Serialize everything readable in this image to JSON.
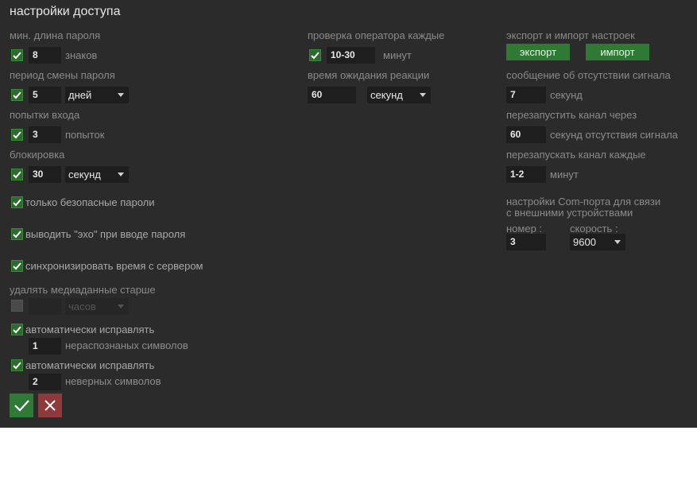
{
  "title": "настройки доступа",
  "left": {
    "min_length": {
      "label": "мин. длина пароля",
      "value": "8",
      "unit": "знаков"
    },
    "change_period": {
      "label": "период смены пароля",
      "value": "5",
      "unit_select": "дней"
    },
    "login_attempts": {
      "label": "попытки входа",
      "value": "3",
      "unit": "попыток"
    },
    "lockout": {
      "label": "блокировка",
      "value": "30",
      "unit_select": "секунд"
    },
    "safe_only": "только безопасные пароли",
    "echo": "выводить \"эхо\" при вводе пароля",
    "sync_time": "синхронизировать время с сервером",
    "delete_media": {
      "label": "удалять медиаданные старше",
      "value": "",
      "unit_select": "часов"
    },
    "autofix_unrecognized": {
      "label": "автоматически исправлять",
      "value": "1",
      "unit": "нераспознаных символов"
    },
    "autofix_wrong": {
      "label": "автоматически исправлять",
      "value": "2",
      "unit": "неверных символов"
    }
  },
  "middle": {
    "operator_check": {
      "label": "проверка оператора каждые",
      "value": "10-30",
      "unit": "минут"
    },
    "reaction_wait": {
      "label": "время ожидания реакции",
      "value": "60",
      "unit_select": "секунд"
    }
  },
  "right": {
    "export_import": {
      "label": "экспорт и импорт настроек",
      "export": "экспорт",
      "import": "импорт"
    },
    "no_signal_msg": {
      "label": "сообщение об отсутствии сигнала",
      "value": "7",
      "unit": "секунд"
    },
    "restart_channel_after": {
      "label": "перезапустить канал через",
      "value": "60",
      "unit": "секунд отсутствия сигнала"
    },
    "restart_channel_every": {
      "label": "перезапускать канал каждые",
      "value": "1-2",
      "unit": "минут"
    },
    "com_port": {
      "label_line1": "настройки Com-порта для связи",
      "label_line2": "с внешними устройствами",
      "number_label": "номер :",
      "number_value": "3",
      "speed_label": "скорость :",
      "speed_value": "9600"
    }
  },
  "colors": {
    "panel": "#2b2b2b",
    "accent_green": "#2e7a35",
    "cancel_red": "#8e3a3a"
  },
  "icons": {
    "ok": "check-icon",
    "cancel": "close-icon",
    "checkbox": "checkmark-icon",
    "dropdown": "chevron-down-icon"
  }
}
